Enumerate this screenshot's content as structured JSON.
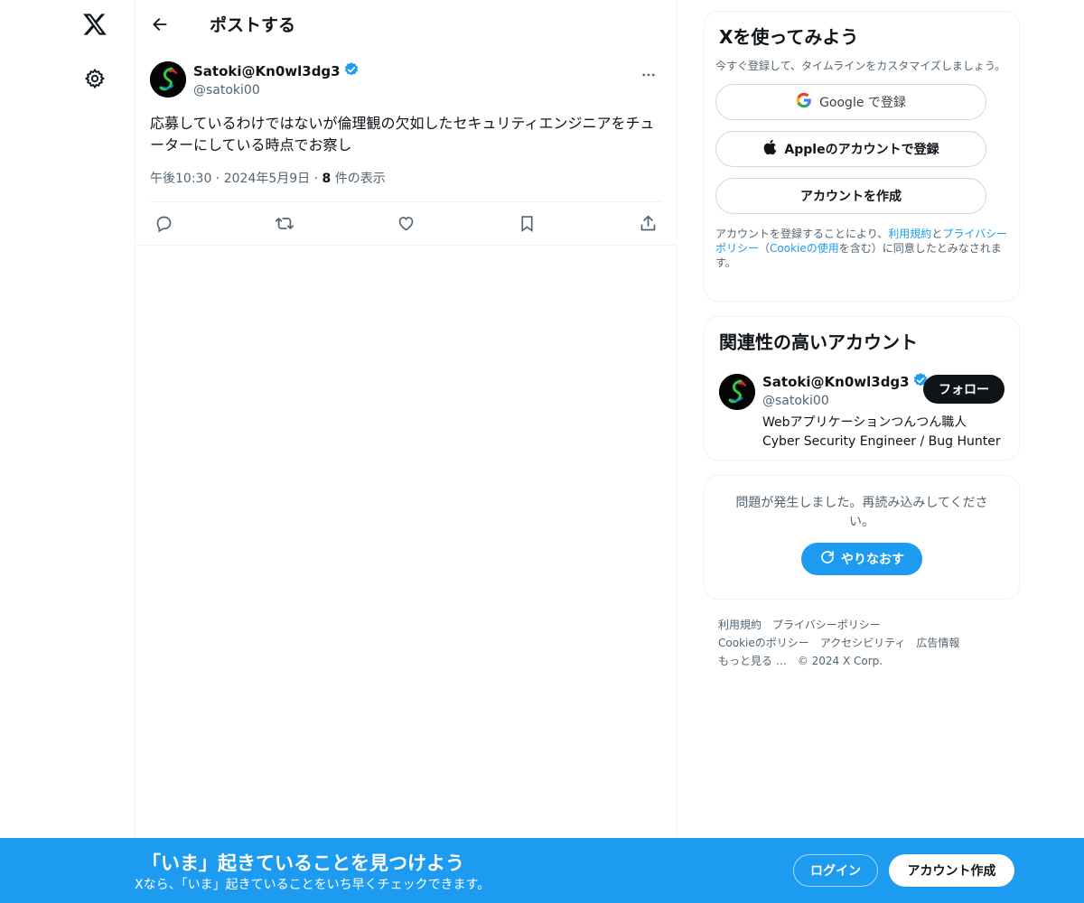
{
  "nav": {
    "logo_icon": "x-logo-icon",
    "settings_icon": "gear-icon"
  },
  "header": {
    "title": "ポストする"
  },
  "tweet": {
    "author_name": "Satoki@Kn0wl3dg3",
    "author_handle": "@satoki00",
    "text": "応募しているわけではないが倫理観の欠如したセキュリティエンジニアをチューターにしている時点でお察し",
    "time": "午後10:30",
    "sep1": " · ",
    "date": "2024年5月9日",
    "sep2": " · ",
    "views_count": "8",
    "views_label": " 件の表示"
  },
  "signup": {
    "title": "Xを使ってみよう",
    "subtitle": "今すぐ登録して、タイムラインをカスタマイズしましょう。",
    "google_label": "Google で登録",
    "apple_label": "Appleのアカウントで登録",
    "create_label": "アカウントを作成",
    "legal_prefix": "アカウントを登録することにより、",
    "legal_terms": "利用規約",
    "legal_and": "と",
    "legal_privacy": "プライバシーポリシー",
    "legal_paren_open": "（",
    "legal_cookie": "Cookieの使用",
    "legal_suffix": "を含む）に同意したとみなされます。"
  },
  "related": {
    "title": "関連性の高いアカウント",
    "name": "Satoki@Kn0wl3dg3",
    "handle": "@satoki00",
    "bio_line1": "Webアプリケーションつんつん職人",
    "bio_line2": "Cyber Security Engineer / Bug Hunter",
    "follow_label": "フォロー"
  },
  "error": {
    "message": "問題が発生しました。再読み込みしてください。",
    "retry_label": "やりなおす"
  },
  "footer": {
    "terms": "利用規約",
    "privacy": "プライバシーポリシー",
    "cookie": "Cookieのポリシー",
    "accessibility": "アクセシビリティ",
    "ads": "広告情報",
    "more": "もっと見る …",
    "copyright": "© 2024 X Corp."
  },
  "banner": {
    "title": "「いま」起きていることを見つけよう",
    "subtitle": "Xなら、「いま」起きていることをいち早くチェックできます。",
    "login_label": "ログイン",
    "signup_label": "アカウント作成"
  },
  "colors": {
    "accent": "#1d9bf0",
    "text": "#0f1419",
    "muted": "#536471",
    "border": "#eff3f4"
  }
}
